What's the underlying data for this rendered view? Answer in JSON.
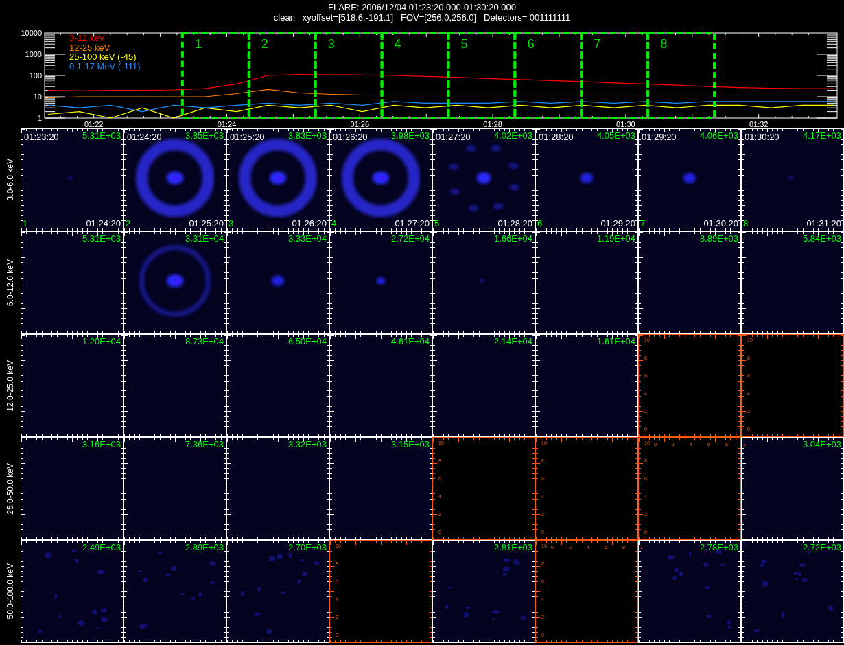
{
  "title": "FLARE: 2006/12/04 01:23:20.000-01:30:20.000",
  "subtitle": "clean   xyoffset=[518.6,-191.1]   FOV=[256.0,256.0]   Detectors= 001111111",
  "lightcurve": {
    "y_axis_labels": [
      "10000",
      "1000",
      "100",
      "10",
      "1"
    ],
    "x_axis_labels": [
      "01:22",
      "01:24",
      "01:26",
      "01:28",
      "01:30",
      "01:32"
    ],
    "legend": [
      {
        "name": "3-12 keV",
        "color": "#ff0000"
      },
      {
        "name": "12-25 keV",
        "color": "#ff8000"
      },
      {
        "name": "25-100 keV (-45)",
        "color": "#ffff00"
      },
      {
        "name": "0.1-17 MeV (-111)",
        "color": "#1e90ff"
      }
    ],
    "windows": [
      {
        "label": "1"
      },
      {
        "label": "2"
      },
      {
        "label": "3"
      },
      {
        "label": "4"
      },
      {
        "label": "5"
      },
      {
        "label": "6"
      },
      {
        "label": "7"
      },
      {
        "label": "8"
      }
    ]
  },
  "rows": [
    {
      "band": "3.0-6.0 keV",
      "cells": [
        {
          "start": "01:23:20",
          "peak": "5.31E+03",
          "index": "1",
          "end": "01:24:20"
        },
        {
          "start": "01:24:20",
          "peak": "3.85E+03",
          "index": "2",
          "end": "01:25:20"
        },
        {
          "start": "01:25:20",
          "peak": "3.83E+03",
          "index": "3",
          "end": "01:26:20"
        },
        {
          "start": "01:26:20",
          "peak": "3.98E+03",
          "index": "4",
          "end": "01:27:20"
        },
        {
          "start": "01:27:20",
          "peak": "4.02E+03",
          "index": "5",
          "end": "01:28:20"
        },
        {
          "start": "01:28:20",
          "peak": "4.05E+03",
          "index": "6",
          "end": "01:29:20"
        },
        {
          "start": "01:29:20",
          "peak": "4.06E+03",
          "index": "7",
          "end": "01:30:20"
        },
        {
          "start": "01:30:20",
          "peak": "4.17E+03",
          "index": "8",
          "end": "01:31:20"
        }
      ]
    },
    {
      "band": "6.0-12.0 keV",
      "cells": [
        {
          "peak": "5.31E+03"
        },
        {
          "peak": "3.31E+04"
        },
        {
          "peak": "3.33E+04"
        },
        {
          "peak": "2.72E+04"
        },
        {
          "peak": "1.66E+04"
        },
        {
          "peak": "1.19E+04"
        },
        {
          "peak": "8.89E+03"
        },
        {
          "peak": "5.84E+03"
        }
      ]
    },
    {
      "band": "12.0-25.0 keV",
      "cells": [
        {
          "peak": "1.20E+04"
        },
        {
          "peak": "8.73E+04"
        },
        {
          "peak": "6.50E+04"
        },
        {
          "peak": "4.61E+04"
        },
        {
          "peak": "2.14E+04"
        },
        {
          "peak": "1.61E+04"
        },
        {
          "kind": "empty",
          "y_tick_labels": [
            "10",
            "8",
            "6",
            "4",
            "2",
            "0"
          ],
          "x_tick_labels": [
            "0",
            "2",
            "4",
            "6",
            "8",
            "1"
          ]
        },
        {
          "kind": "empty",
          "y_tick_labels": [
            "10",
            "8",
            "6",
            "4",
            "2",
            "0"
          ]
        }
      ]
    },
    {
      "band": "25.0-50.0 keV",
      "cells": [
        {
          "peak": "3.16E+03"
        },
        {
          "peak": "7.36E+03"
        },
        {
          "peak": "3.32E+03"
        },
        {
          "peak": "3.15E+03"
        },
        {
          "kind": "empty",
          "y_tick_labels": [
            "10",
            "8",
            "6",
            "4",
            "2",
            "0"
          ]
        },
        {
          "kind": "empty",
          "y_tick_labels": [
            "10",
            "8",
            "6",
            "4",
            "2",
            "0"
          ],
          "x_tick_labels": [
            "0",
            "2",
            "4",
            "6",
            "8",
            "1"
          ]
        },
        {
          "kind": "empty",
          "y_tick_labels": [
            "10",
            "8",
            "6",
            "4",
            "2",
            "0"
          ]
        },
        {
          "peak": "3.04E+03"
        }
      ]
    },
    {
      "band": "50.0-100.0 keV",
      "cells": [
        {
          "peak": "2.49E+03"
        },
        {
          "peak": "2.89E+03"
        },
        {
          "peak": "2.70E+03"
        },
        {
          "kind": "empty",
          "y_tick_labels": [
            "10",
            "8",
            "6",
            "4",
            "2",
            "0"
          ]
        },
        {
          "peak": "2.81E+03"
        },
        {
          "kind": "empty",
          "y_tick_labels": [
            "10",
            "8",
            "6",
            "4",
            "2",
            "0"
          ]
        },
        {
          "peak": "2.78E+03"
        },
        {
          "peak": "2.72E+03"
        }
      ]
    }
  ]
}
